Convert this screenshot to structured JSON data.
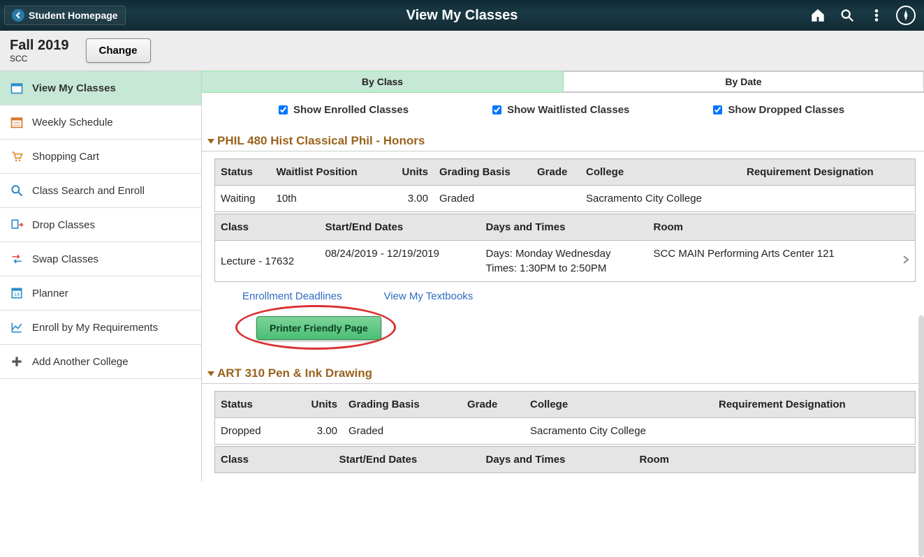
{
  "header": {
    "back_label": "Student Homepage",
    "title": "View My Classes"
  },
  "term": {
    "name": "Fall 2019",
    "college": "SCC",
    "change_label": "Change"
  },
  "sidebar": {
    "items": [
      {
        "label": "View My Classes",
        "active": true
      },
      {
        "label": "Weekly Schedule"
      },
      {
        "label": "Shopping Cart"
      },
      {
        "label": "Class Search and Enroll"
      },
      {
        "label": "Drop Classes"
      },
      {
        "label": "Swap Classes"
      },
      {
        "label": "Planner"
      },
      {
        "label": "Enroll by My Requirements"
      },
      {
        "label": "Add Another College"
      }
    ]
  },
  "tabs": {
    "by_class": "By Class",
    "by_date": "By Date"
  },
  "filters": {
    "enrolled": "Show Enrolled Classes",
    "waitlisted": "Show Waitlisted Classes",
    "dropped": "Show Dropped Classes"
  },
  "courses": [
    {
      "title": "PHIL 480 Hist Classical Phil - Honors",
      "status_table": {
        "headers": [
          "Status",
          "Waitlist Position",
          "Units",
          "Grading Basis",
          "Grade",
          "College",
          "Requirement Designation"
        ],
        "row": {
          "status": "Waiting",
          "waitlist": "10th",
          "units": "3.00",
          "grading": "Graded",
          "grade": "",
          "college": "Sacramento City College",
          "reqdes": ""
        }
      },
      "schedule_table": {
        "headers": [
          "Class",
          "Start/End Dates",
          "Days and Times",
          "Room"
        ],
        "row": {
          "class": "Lecture - 17632",
          "dates": "08/24/2019 - 12/19/2019",
          "days": "Days: Monday Wednesday",
          "times": "Times: 1:30PM to 2:50PM",
          "room": "SCC MAIN Performing Arts Center 121"
        }
      },
      "links": {
        "deadlines": "Enrollment Deadlines",
        "textbooks": "View My Textbooks"
      },
      "printer_label": "Printer Friendly Page"
    },
    {
      "title": "ART 310 Pen & Ink Drawing",
      "status_table": {
        "headers": [
          "Status",
          "Units",
          "Grading Basis",
          "Grade",
          "College",
          "Requirement Designation"
        ],
        "row": {
          "status": "Dropped",
          "units": "3.00",
          "grading": "Graded",
          "grade": "",
          "college": "Sacramento City College",
          "reqdes": ""
        }
      },
      "schedule_table": {
        "headers": [
          "Class",
          "Start/End Dates",
          "Days and Times",
          "Room"
        ]
      }
    }
  ]
}
